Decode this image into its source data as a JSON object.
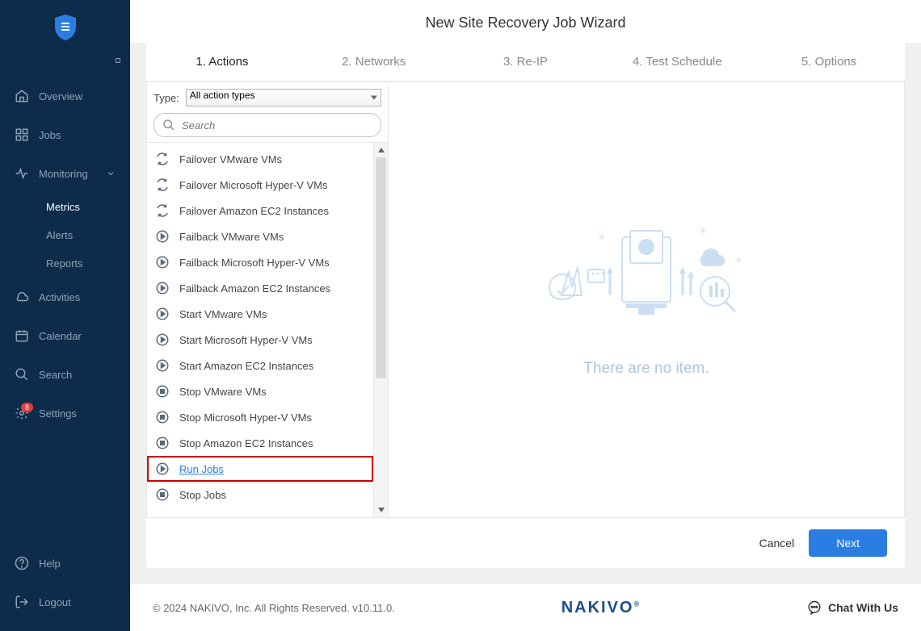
{
  "sidebar": {
    "items": [
      {
        "icon": "home",
        "label": "Overview"
      },
      {
        "icon": "grid",
        "label": "Jobs"
      },
      {
        "icon": "pulse",
        "label": "Monitoring",
        "expandable": true
      }
    ],
    "subitems": [
      {
        "label": "Metrics",
        "active": true
      },
      {
        "label": "Alerts"
      },
      {
        "label": "Reports"
      }
    ],
    "items2": [
      {
        "icon": "cloud",
        "label": "Activities"
      },
      {
        "icon": "calendar",
        "label": "Calendar"
      },
      {
        "icon": "search",
        "label": "Search"
      },
      {
        "icon": "gear",
        "label": "Settings",
        "badge": "8"
      }
    ],
    "bottom": [
      {
        "icon": "help",
        "label": "Help"
      },
      {
        "icon": "logout",
        "label": "Logout"
      }
    ]
  },
  "wizard": {
    "title": "New Site Recovery Job Wizard",
    "steps": [
      "1. Actions",
      "2. Networks",
      "3. Re-IP",
      "4. Test Schedule",
      "5. Options"
    ],
    "active_step": 0,
    "type_label": "Type:",
    "type_value": "All action types",
    "search_placeholder": "Search",
    "actions": [
      {
        "icon": "failover",
        "label": "Failover VMware VMs"
      },
      {
        "icon": "failover",
        "label": "Failover Microsoft Hyper-V VMs"
      },
      {
        "icon": "failover",
        "label": "Failover Amazon EC2 Instances"
      },
      {
        "icon": "play",
        "label": "Failback VMware VMs"
      },
      {
        "icon": "play",
        "label": "Failback Microsoft Hyper-V VMs"
      },
      {
        "icon": "play",
        "label": "Failback Amazon EC2 Instances"
      },
      {
        "icon": "play",
        "label": "Start VMware VMs"
      },
      {
        "icon": "play",
        "label": "Start Microsoft Hyper-V VMs"
      },
      {
        "icon": "play",
        "label": "Start Amazon EC2 Instances"
      },
      {
        "icon": "stop",
        "label": "Stop VMware VMs"
      },
      {
        "icon": "stop",
        "label": "Stop Microsoft Hyper-V VMs"
      },
      {
        "icon": "stop",
        "label": "Stop Amazon EC2 Instances"
      },
      {
        "icon": "play",
        "label": "Run Jobs",
        "highlighted": true
      },
      {
        "icon": "stop",
        "label": "Stop Jobs"
      }
    ],
    "empty_text": "There are no item.",
    "cancel_label": "Cancel",
    "next_label": "Next"
  },
  "footer": {
    "copyright": "© 2024 NAKIVO, Inc. All Rights Reserved. v10.11.0.",
    "brand": "NAKIVO",
    "chat": "Chat With Us"
  }
}
